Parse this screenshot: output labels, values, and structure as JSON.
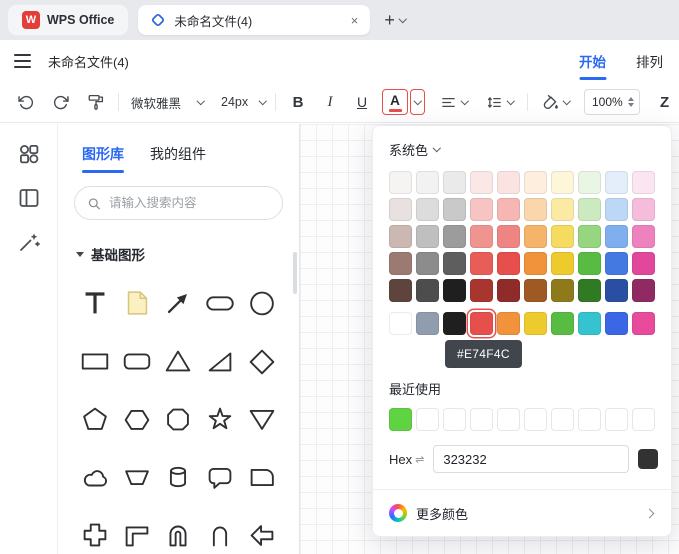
{
  "doc_title": "未命名文件(4)",
  "tabbar": {
    "wps_tab_label": "WPS Office"
  },
  "menubar": {
    "menu_start": "开始",
    "menu_arrange": "排列"
  },
  "toolbar": {
    "font_name": "微软雅黑",
    "font_size": "24px",
    "bold": "B",
    "italic": "I",
    "underline": "U",
    "font_color_letter": "A",
    "zoom_value": "100%",
    "more_letter": "Z"
  },
  "panel": {
    "tab_shapes": "图形库",
    "tab_components": "我的组件",
    "search_placeholder": "请输入搜索内容",
    "section_basic": "基础图形",
    "shapes": [
      "text",
      "note",
      "arrow",
      "pill",
      "circle",
      "rect",
      "rounded-rect",
      "triangle",
      "right-triangle",
      "diamond",
      "pentagon",
      "hexagon",
      "octagon",
      "star",
      "inverted-triangle",
      "cloud",
      "trapezoid",
      "cylinder",
      "speech-bubble",
      "card",
      "cross",
      "corner",
      "arch",
      "arch-thin",
      "arrow-left"
    ]
  },
  "popup": {
    "system_label": "系统色",
    "recent_label": "最近使用",
    "hex_label": "Hex",
    "hex_value": "323232",
    "hex_preview": "#323232",
    "more_label": "更多颜色",
    "tooltip": "#E74F4C",
    "selected_color": "#E74F4C",
    "standard_selected_index": 3,
    "theme_grid": [
      [
        "#F6F3F3",
        "#F2F2F2",
        "#EAEAEA",
        "#FBE7E6",
        "#FBE3E2",
        "#FDEEDD",
        "#FDF6D9",
        "#E9F6E4",
        "#E4EEFB",
        "#FBE5F1"
      ],
      [
        "#E9E1DF",
        "#DCDCDC",
        "#C9C9C9",
        "#F6C5C3",
        "#F5B6B4",
        "#F9D6AC",
        "#FAEAA4",
        "#CBEABF",
        "#BDD8F6",
        "#F5BCDC"
      ],
      [
        "#CBB8B3",
        "#BFBFBF",
        "#9C9C9C",
        "#F09490",
        "#EF8583",
        "#F5B469",
        "#F5DB5F",
        "#95D67F",
        "#7FAFEE",
        "#EE82BE"
      ],
      [
        "#9C7A72",
        "#8C8C8C",
        "#5E5E5E",
        "#E85D57",
        "#E74F4C",
        "#F0933B",
        "#EECB2D",
        "#58BC42",
        "#4479E2",
        "#E2479C"
      ],
      [
        "#5E443D",
        "#4D4D4D",
        "#1F1F1F",
        "#A8362F",
        "#8F2B28",
        "#9E5A22",
        "#8F7A1B",
        "#2F7A22",
        "#2A4FA2",
        "#8F2B62"
      ]
    ],
    "standard_row": [
      "#FFFFFF",
      "#8F9DAF",
      "#1F1F1F",
      "#E74F4C",
      "#F0933B",
      "#EECB2D",
      "#58BC42",
      "#35C4CF",
      "#3B66E5",
      "#E84A9C"
    ],
    "recent_colors": [
      "#5FD341",
      "",
      "",
      "",
      "",
      "",
      "",
      "",
      "",
      ""
    ]
  },
  "icons": {
    "plus": "+",
    "close": "×",
    "hex_swap": "⇌"
  },
  "colors": {
    "accent_blue": "#2A6AF2",
    "selection_red": "#E74F4C"
  }
}
